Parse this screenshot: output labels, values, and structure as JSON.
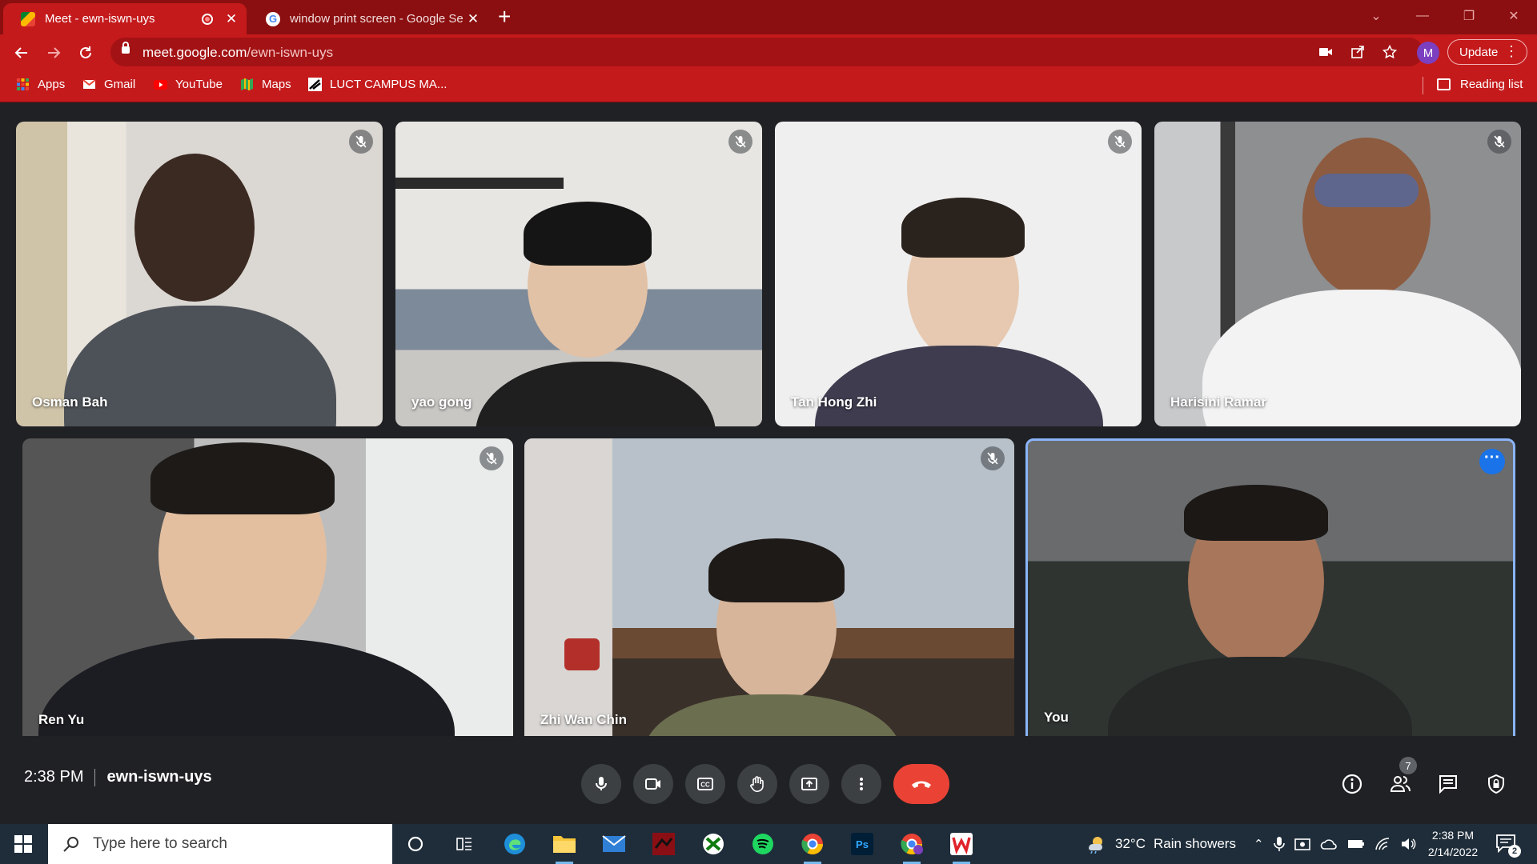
{
  "browser": {
    "tabs": [
      {
        "title": "Meet - ewn-iswn-uys",
        "active": true
      },
      {
        "title": "window print screen - Google Se",
        "active": false
      }
    ],
    "url_domain": "meet.google.com",
    "url_path": "/ewn-iswn-uys",
    "profile_initial": "M",
    "update_label": "Update",
    "bookmarks": [
      {
        "label": "Apps",
        "icon": "apps-grid-icon"
      },
      {
        "label": "Gmail",
        "icon": "gmail-icon"
      },
      {
        "label": "YouTube",
        "icon": "youtube-icon"
      },
      {
        "label": "Maps",
        "icon": "maps-icon"
      },
      {
        "label": "LUCT CAMPUS MA...",
        "icon": "luct-icon"
      }
    ],
    "reading_list": "Reading list",
    "accent": "#c41a1c"
  },
  "meet": {
    "participants": [
      {
        "name": "Osman Bah",
        "muted": true
      },
      {
        "name": "yao gong",
        "muted": true
      },
      {
        "name": "Tan Hong Zhi",
        "muted": true
      },
      {
        "name": "Harisini Ramar",
        "muted": true
      },
      {
        "name": "Ren Yu",
        "muted": true
      },
      {
        "name": "Zhi Wan Chin",
        "muted": true
      },
      {
        "name": "You",
        "muted": false
      }
    ],
    "time": "2:38 PM",
    "meeting_code": "ewn-iswn-uys",
    "people_count": "7",
    "end_call_color": "#ea4335"
  },
  "taskbar": {
    "search_placeholder": "Type here to search",
    "weather_temp": "32°C",
    "weather_text": "Rain showers",
    "clock_time": "2:38 PM",
    "clock_date": "2/14/2022",
    "notification_count": "2"
  }
}
